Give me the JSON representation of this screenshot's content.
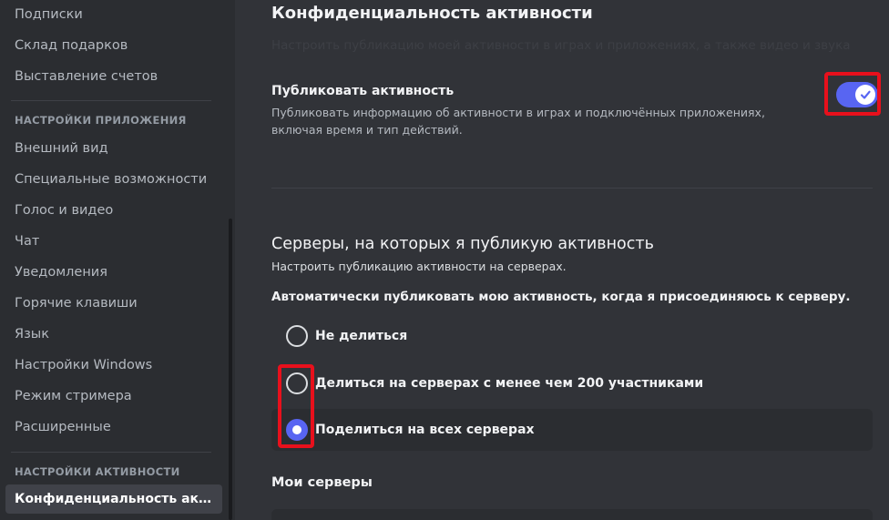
{
  "sidebar": {
    "items_top": [
      {
        "label": "Подписки"
      },
      {
        "label": "Склад подарков"
      },
      {
        "label": "Выставление счетов"
      }
    ],
    "app_settings_header": "НАСТРОЙКИ ПРИЛОЖЕНИЯ",
    "app_items": [
      {
        "label": "Внешний вид"
      },
      {
        "label": "Специальные возможности"
      },
      {
        "label": "Голос и видео"
      },
      {
        "label": "Чат"
      },
      {
        "label": "Уведомления"
      },
      {
        "label": "Горячие клавиши"
      },
      {
        "label": "Язык"
      },
      {
        "label": "Настройки Windows"
      },
      {
        "label": "Режим стримера"
      },
      {
        "label": "Расширенные"
      }
    ],
    "activity_settings_header": "НАСТРОЙКИ АКТИВНОСТИ",
    "activity_items": [
      {
        "label": "Конфиденциальность активности"
      }
    ]
  },
  "main": {
    "title": "Конфиденциальность активности",
    "faded_subtitle": "Настроить публикацию моей активности в играх и приложениях, а также видео и звука",
    "publish_activity": {
      "title": "Публиковать активность",
      "description": "Публиковать информацию об активности в играх и подключённых приложениях, включая время и тип действий.",
      "enabled": true
    },
    "servers_section": {
      "title": "Серверы, на которых я публикую активность",
      "description": "Настроить публикацию активности на серверах.",
      "question": "Автоматически публиковать мою активность, когда я присоединяюсь к серверу.",
      "options": [
        {
          "label": "Не делиться",
          "selected": false
        },
        {
          "label": "Делиться на серверах с менее чем 200 участниками",
          "selected": false
        },
        {
          "label": "Поделиться на всех серверах",
          "selected": true
        }
      ]
    },
    "my_servers_title": "Мои серверы"
  },
  "colors": {
    "accent": "#5865f2",
    "highlight": "#e8101c",
    "background": "#313338",
    "sidebar": "#2b2d31"
  }
}
